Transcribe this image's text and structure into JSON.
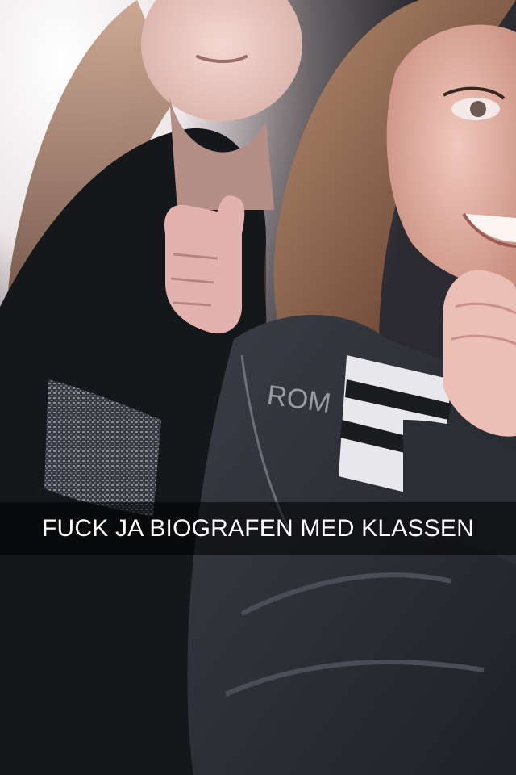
{
  "snap": {
    "caption": "FUCK JA BIOGRAFEN MED KLASSEN"
  },
  "photo": {
    "subject": "selfie"
  }
}
